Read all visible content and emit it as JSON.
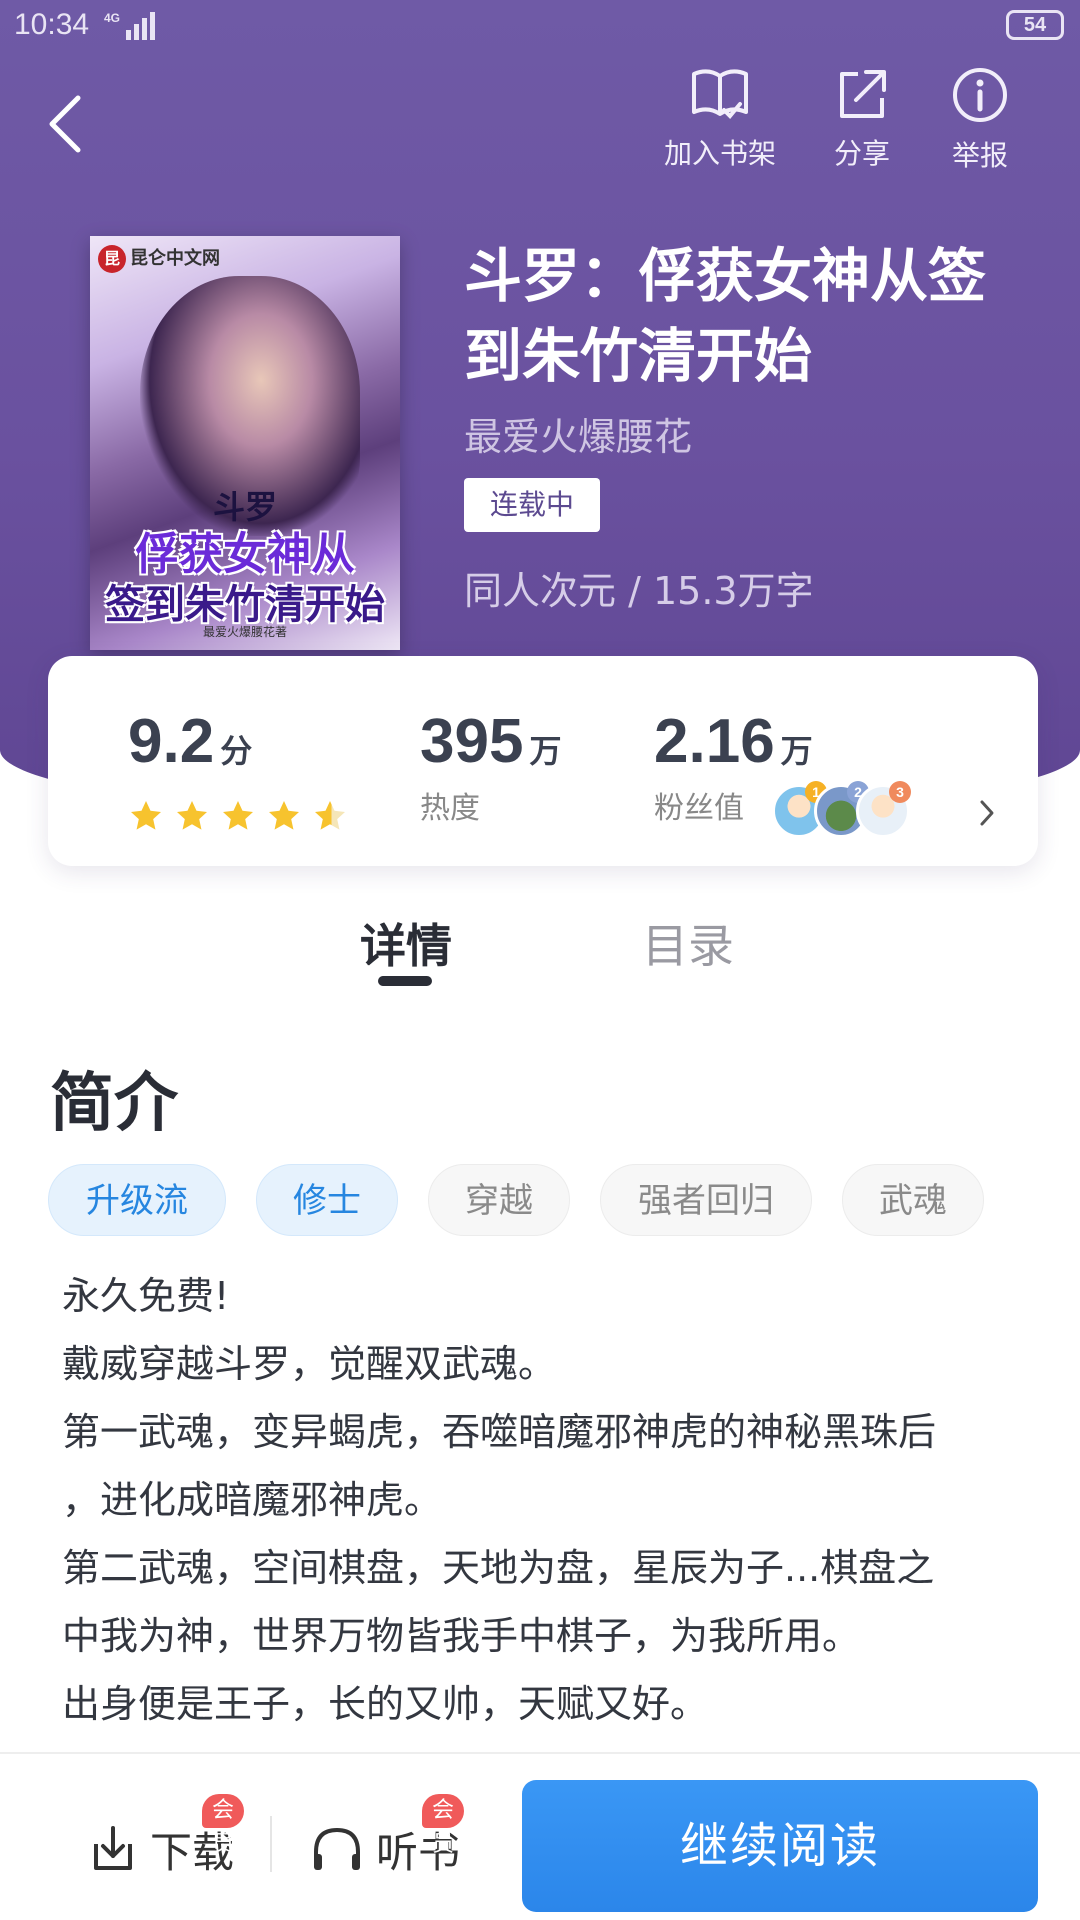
{
  "status_bar": {
    "time": "10:34",
    "network": "4G",
    "battery": "54"
  },
  "top_actions": {
    "bookshelf": "加入书架",
    "share": "分享",
    "report": "举报"
  },
  "book": {
    "cover": {
      "publisher": "昆仑中文网",
      "publisher_seal": "昆",
      "line1": "斗罗",
      "line2": "俘获女神从",
      "line3": "签到朱竹清开始",
      "byline": "最爱火爆腰花著"
    },
    "title": "斗罗：俘获女神从签到朱竹清开始",
    "author": "最爱火爆腰花",
    "status": "连载中",
    "meta": "同人次元 / 15.3万字"
  },
  "stats": {
    "score": {
      "value": "9.2",
      "unit": "分",
      "stars": 4.5
    },
    "heat": {
      "value": "395",
      "unit": "万",
      "label": "热度"
    },
    "fans": {
      "value": "2.16",
      "unit": "万",
      "label": "粉丝值",
      "avatar_ranks": [
        "1",
        "2",
        "3"
      ]
    }
  },
  "tabs": {
    "detail": "详情",
    "catalog": "目录"
  },
  "intro": {
    "title": "简介",
    "tags": [
      "升级流",
      "修士",
      "穿越",
      "强者回归",
      "武魂"
    ],
    "lines": [
      "永久免费!",
      "戴威穿越斗罗，觉醒双武魂。",
      "第一武魂，变异蝎虎，吞噬暗魔邪神虎的神秘黑珠后",
      "，进化成暗魔邪神虎。",
      "第二武魂，空间棋盘，天地为盘，星辰为子...棋盘之",
      "中我为神，世界万物皆我手中棋子，为我所用。",
      "出身便是王子，长的又帅，天赋又好。"
    ]
  },
  "bottom_bar": {
    "download": "下载",
    "listen": "听书",
    "vip_badge": "会员",
    "continue": "继续阅读"
  },
  "colors": {
    "header_purple": "#6a519f",
    "accent_blue": "#2b86ea",
    "tag_blue": "#2686e0",
    "star_yellow": "#f7c32e",
    "vip_red": "#f05a5a"
  }
}
